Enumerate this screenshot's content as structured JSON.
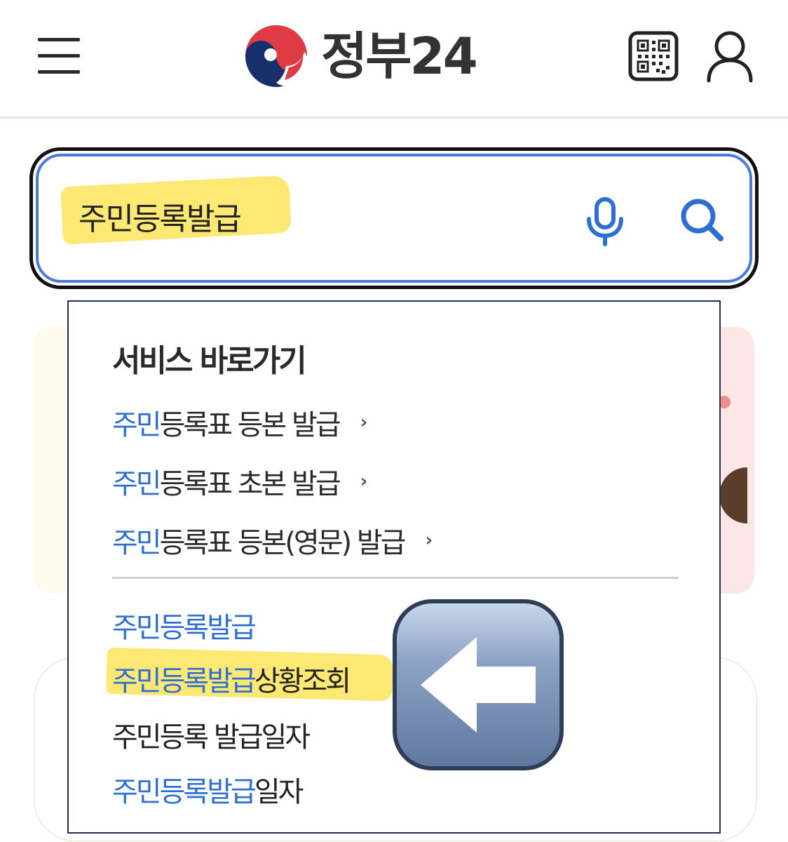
{
  "header": {
    "logo_text": "정부24",
    "menu_icon": "hamburger-menu-icon",
    "qr_icon": "qr-code-icon",
    "user_icon": "user-icon"
  },
  "search": {
    "value": "주민등록발급",
    "mic_icon": "microphone-icon",
    "search_icon": "search-icon",
    "accent_color": "#4a7bd8"
  },
  "dropdown": {
    "heading": "서비스 바로가기",
    "services": [
      {
        "match": "주민",
        "rest": "등록표 등본 발급",
        "chevron": "›"
      },
      {
        "match": "주민",
        "rest": "등록표 초본 발급",
        "chevron": "›"
      },
      {
        "match": "주민",
        "rest": "등록표 등본(영문) 발급",
        "chevron": "›"
      }
    ],
    "suggestions": [
      {
        "match": "주민등록발급",
        "rest": ""
      },
      {
        "match": "주민등록발급",
        "rest": "상황조회"
      },
      {
        "match": "",
        "rest": "주민등록 발급일자"
      },
      {
        "match": "주민등록발급",
        "rest": "일자"
      }
    ],
    "highlight_color": "#2f6fd1"
  },
  "overlay": {
    "arrow_icon": "left-arrow-emoji-icon"
  }
}
